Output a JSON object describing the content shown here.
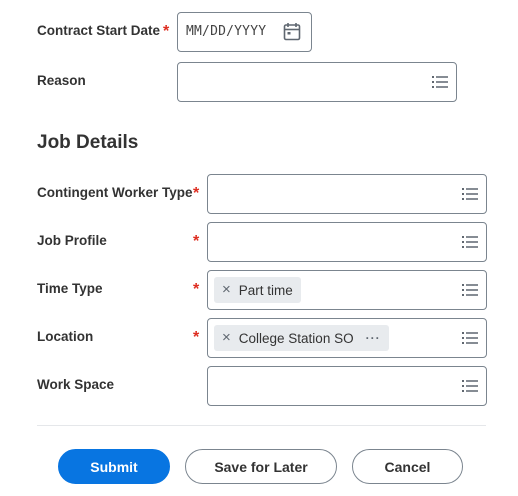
{
  "contract_start_date": {
    "label": "Contract Start Date",
    "required_mark": "*",
    "placeholder": "MM/DD/YYYY",
    "icon": "calendar-icon"
  },
  "reason": {
    "label": "Reason",
    "value": "",
    "icon": "prompt-list-icon"
  },
  "job_details": {
    "heading": "Job Details",
    "fields": [
      {
        "label": "Contingent Worker Type",
        "required_mark": "*",
        "value": ""
      },
      {
        "label": "Job Profile",
        "required_mark": "*",
        "value": ""
      },
      {
        "label": "Time Type",
        "required_mark": "*",
        "selected": "Part time"
      },
      {
        "label": "Location",
        "required_mark": "*",
        "selected": "College Station SO",
        "more_glyph": "···"
      },
      {
        "label": "Work Space",
        "value": ""
      }
    ]
  },
  "pill_remove_glyph": "×",
  "buttons": {
    "submit": "Submit",
    "save_for_later": "Save for Later",
    "cancel": "Cancel"
  },
  "colors": {
    "primary": "#0875e1",
    "required": "#de2e21",
    "border": "#7b858f",
    "pill_bg": "#e8ebee"
  }
}
